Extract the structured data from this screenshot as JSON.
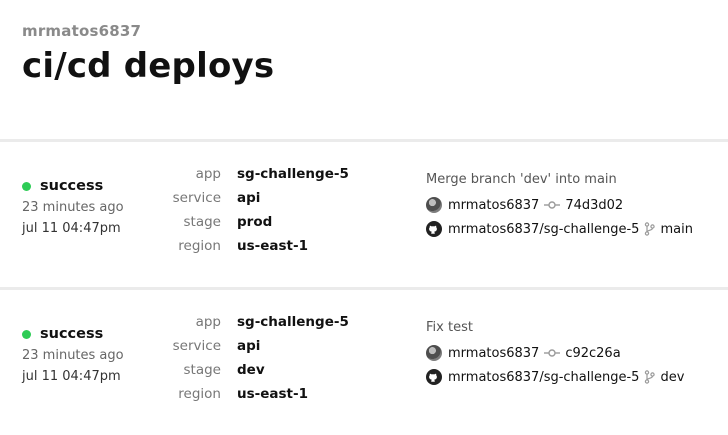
{
  "header": {
    "org": "mrmatos6837",
    "title": "ci/cd deploys"
  },
  "field_keys": {
    "app": "app",
    "service": "service",
    "stage": "stage",
    "region": "region"
  },
  "colors": {
    "success": "#2ecc56",
    "separator": "#ebebeb"
  },
  "deploys": [
    {
      "status": "success",
      "ago": "23 minutes ago",
      "date": "jul 11 04:47pm",
      "app": "sg-challenge-5",
      "service": "api",
      "stage": "prod",
      "region": "us-east-1",
      "message": "Merge branch 'dev' into main",
      "author": "mrmatos6837",
      "commit": "74d3d02",
      "repo": "mrmatos6837/sg-challenge-5",
      "branch": "main"
    },
    {
      "status": "success",
      "ago": "23 minutes ago",
      "date": "jul 11 04:47pm",
      "app": "sg-challenge-5",
      "service": "api",
      "stage": "dev",
      "region": "us-east-1",
      "message": "Fix test",
      "author": "mrmatos6837",
      "commit": "c92c26a",
      "repo": "mrmatos6837/sg-challenge-5",
      "branch": "dev"
    }
  ]
}
